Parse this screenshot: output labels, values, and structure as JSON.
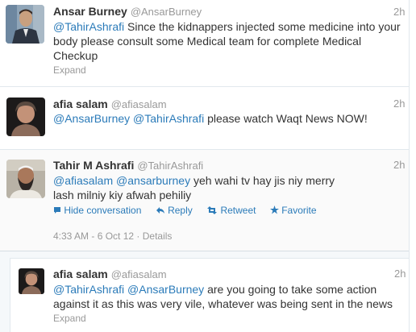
{
  "tweets": [
    {
      "name": "Ansar Burney",
      "handle": "@AnsarBurney",
      "time": "2h",
      "mentions": [
        "@TahirAshrafi"
      ],
      "text": "Since the kidnappers injected some medicine into your body please consult some Medical team for complete Medical Checkup",
      "expand": "Expand"
    },
    {
      "name": "afia salam",
      "handle": "@afiasalam",
      "time": "2h",
      "mentions": [
        "@AnsarBurney",
        "@TahirAshrafi"
      ],
      "text": "please watch Waqt News NOW!",
      "expand": ""
    },
    {
      "name": "Tahir M Ashrafi",
      "handle": "@TahirAshrafi",
      "time": "2h",
      "mentions": [
        "@afiasalam",
        "@ansarburney"
      ],
      "text": "yeh wahi tv hay jis niy merry lash milniy kiy afwah pehiliy",
      "actions": {
        "hide": "Hide conversation",
        "reply": "Reply",
        "retweet": "Retweet",
        "favorite": "Favorite"
      },
      "timestamp": "4:33 AM - 6 Oct 12",
      "details": "Details"
    },
    {
      "name": "afia salam",
      "handle": "@afiasalam",
      "time": "2h",
      "mentions": [
        "@TahirAshrafi",
        "@AnsarBurney"
      ],
      "text": "are you going to take some action against it as this was very vile, whatever was being sent in the news",
      "expand": "Expand"
    }
  ],
  "colors": {
    "link": "#2b7bb9",
    "muted": "#999999",
    "text": "#333333"
  },
  "icons": [
    "speech-bubble-icon",
    "reply-arrow-icon",
    "retweet-icon",
    "star-icon"
  ]
}
